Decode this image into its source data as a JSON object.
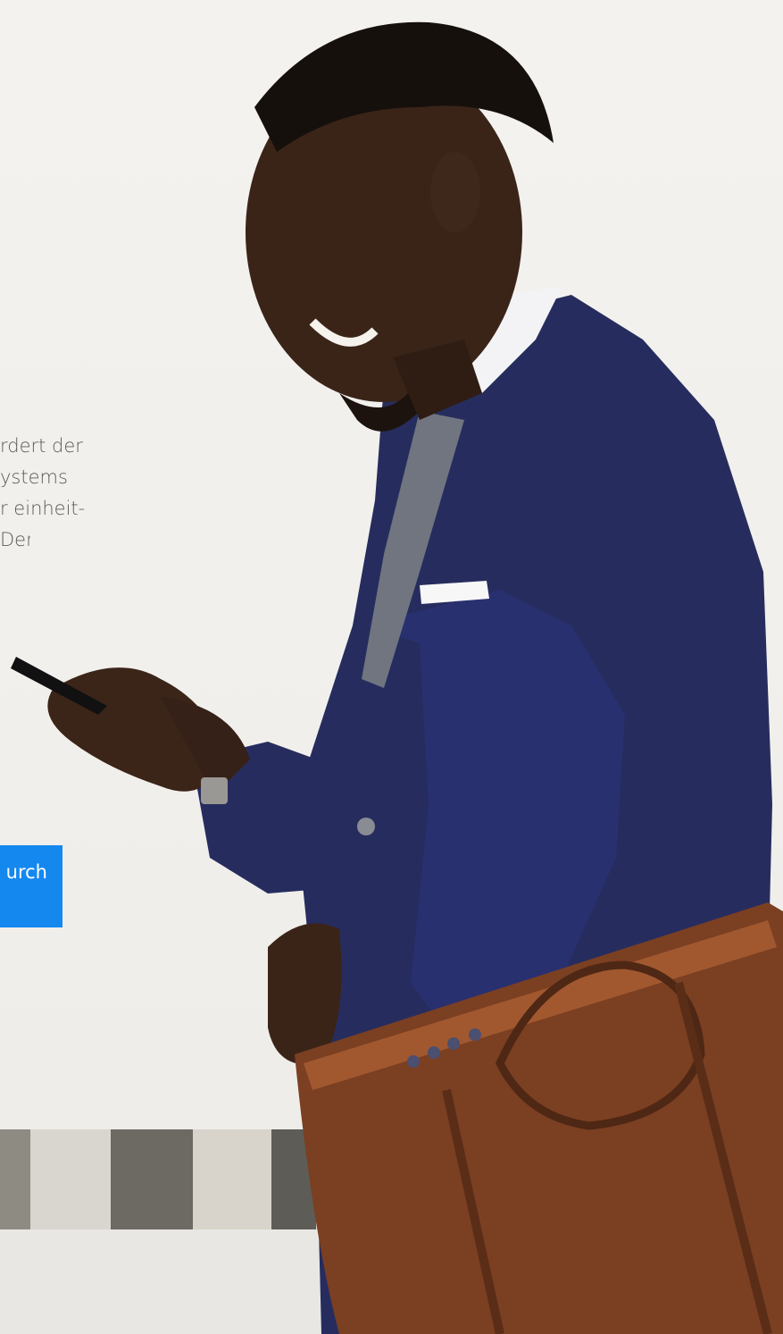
{
  "intro": {
    "lines": [
      "rdert der",
      "ystems",
      "r einheit-",
      "Der"
    ]
  },
  "cta": {
    "label": "urch",
    "color": "#1588f0"
  },
  "photo": {
    "description_icon": "businessman-with-phone-photo"
  }
}
